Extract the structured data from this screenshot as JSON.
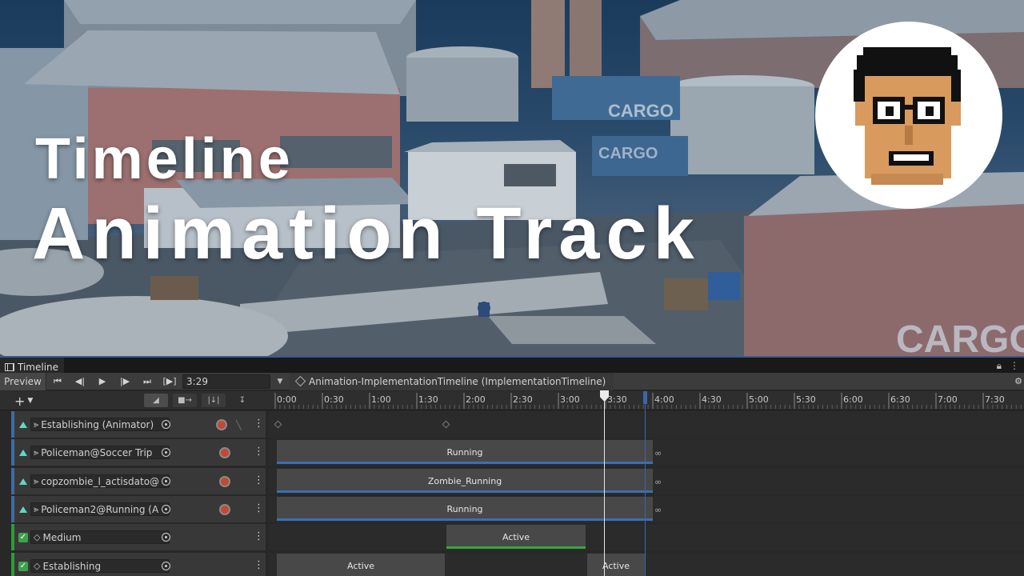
{
  "hero": {
    "title_line1": "Timeline",
    "title_line2": "Animation Track",
    "scene_text_1": "CARGO",
    "scene_text_2": "CARGO",
    "scene_text_3": "CARGO"
  },
  "window": {
    "tab_label": "Timeline",
    "tab_icon": "film-icon",
    "right_icons": [
      "lock-icon",
      "kebab-menu-icon"
    ]
  },
  "toolbar": {
    "preview_label": "Preview",
    "buttons": [
      "first-frame-icon",
      "prev-frame-icon",
      "play-icon",
      "next-frame-icon",
      "last-frame-icon",
      "play-range-icon"
    ],
    "play_range_label": "[▶]",
    "time_value": "3:29",
    "asset_label": "Animation-ImplementationTimeline (ImplementationTimeline)",
    "settings_icon": "gear-icon"
  },
  "header": {
    "add_label": "+",
    "icons": [
      "clip-edit-mode-icon",
      "ripple-mode-icon",
      "replace-mode-icon",
      "snap-icon"
    ],
    "ruler_ticks": [
      "0:00",
      "0:30",
      "1:00",
      "1:30",
      "2:00",
      "2:30",
      "3:00",
      "3:30",
      "4:00",
      "4:30",
      "5:00",
      "5:30",
      "6:00",
      "6:30",
      "7:00",
      "7:30"
    ]
  },
  "tracks": [
    {
      "label": "Establishing (Animator)",
      "icon": "animation-track-icon",
      "kind": "animation",
      "has_record": true,
      "has_curves": true,
      "clips": []
    },
    {
      "label": "Policeman@Soccer Trip",
      "icon": "animation-track-icon",
      "kind": "animation",
      "has_record": true,
      "clips": [
        {
          "label": "Running"
        }
      ],
      "loop": "∞"
    },
    {
      "label": "copzombie_l_actisdato@",
      "icon": "animation-track-icon",
      "kind": "animation",
      "has_record": true,
      "clips": [
        {
          "label": "Zombie_Running"
        }
      ],
      "loop": "∞"
    },
    {
      "label": "Policeman2@Running (A",
      "icon": "animation-track-icon",
      "kind": "animation",
      "has_record": true,
      "clips": [
        {
          "label": "Running"
        }
      ],
      "loop": "∞"
    },
    {
      "label": "Medium",
      "icon": "activation-track-icon",
      "kind": "activation",
      "clips": [
        {
          "label": "Active"
        }
      ]
    },
    {
      "label": "Establishing",
      "icon": "activation-track-icon",
      "kind": "activation",
      "clips": [
        {
          "label": "Active"
        },
        {
          "label": "Active"
        }
      ]
    }
  ],
  "colors": {
    "animation_track": "#3f6aa3",
    "activation_track": "#2e9b3a",
    "clip": "#484848",
    "record": "#c24a30"
  }
}
